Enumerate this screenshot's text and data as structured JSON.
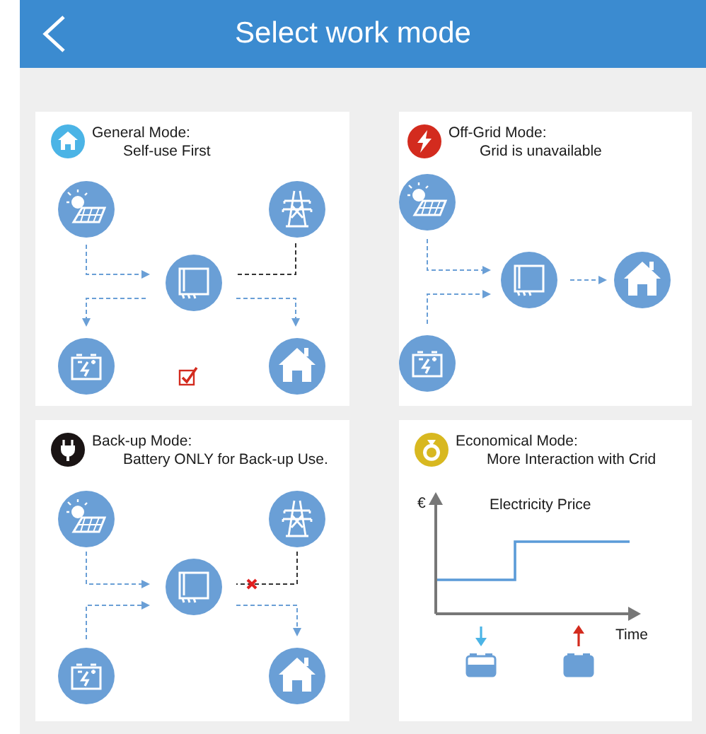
{
  "header": {
    "title": "Select work mode"
  },
  "cards": [
    {
      "kind": "general",
      "title": "General Mode:",
      "subtitle": "Self-use First",
      "selected": true,
      "grid_blocked": false
    },
    {
      "kind": "offgrid",
      "title": "Off-Grid Mode:",
      "subtitle": "Grid is unavailable",
      "selected": false
    },
    {
      "kind": "backup",
      "title": "Back-up Mode:",
      "subtitle": "Battery ONLY for Back-up Use.",
      "selected": false,
      "grid_blocked": true
    },
    {
      "kind": "economical",
      "title": "Economical Mode:",
      "subtitle": "More Interaction with Crid",
      "selected": false,
      "chart_texts": {
        "y_unit": "€",
        "title": "Electricity Price",
        "x_label": "Time"
      }
    }
  ]
}
